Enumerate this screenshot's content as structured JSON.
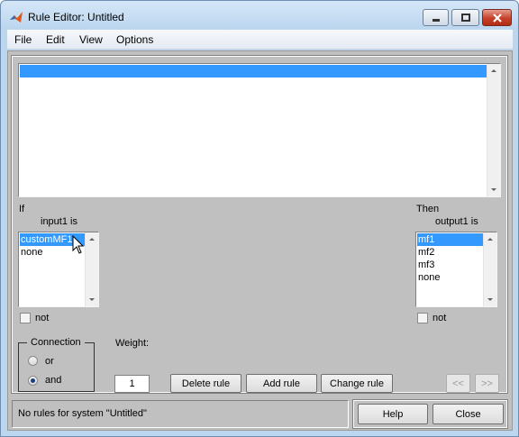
{
  "window": {
    "title": "Rule Editor: Untitled"
  },
  "menu": [
    "File",
    "Edit",
    "View",
    "Options"
  ],
  "input_section": {
    "if_label": "If",
    "var_label": "input1 is",
    "items": [
      "customMF1",
      "none"
    ],
    "selected": "customMF1",
    "not_label": "not"
  },
  "output_section": {
    "then_label": "Then",
    "var_label": "output1 is",
    "items": [
      "mf1",
      "mf2",
      "mf3",
      "none"
    ],
    "selected": "mf1",
    "not_label": "not"
  },
  "connection": {
    "title": "Connection",
    "options": [
      "or",
      "and"
    ],
    "selected": "and"
  },
  "weight": {
    "label": "Weight:",
    "value": "1"
  },
  "buttons": {
    "delete": "Delete rule",
    "add": "Add rule",
    "change": "Change rule",
    "prev": "<<",
    "next": ">>",
    "help": "Help",
    "close": "Close"
  },
  "status": "No rules for system \"Untitled\"",
  "icons": {
    "app": "matlab-logo-icon",
    "minimize": "minimize-icon",
    "maximize": "maximize-icon",
    "close": "close-icon"
  }
}
